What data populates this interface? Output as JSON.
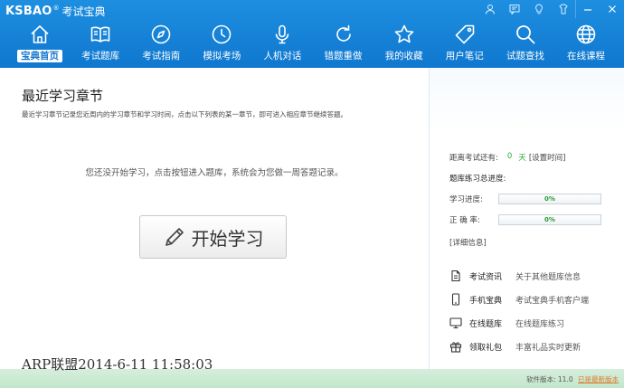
{
  "app": {
    "logo": "KSBAO",
    "registered": "®",
    "name": "考试宝典"
  },
  "nav": [
    {
      "label": "宝典首页",
      "icon": "home-icon",
      "active": true
    },
    {
      "label": "考试题库",
      "icon": "book-icon"
    },
    {
      "label": "考试指南",
      "icon": "compass-icon"
    },
    {
      "label": "模拟考场",
      "icon": "clock-icon"
    },
    {
      "label": "人机对话",
      "icon": "microphone-icon"
    },
    {
      "label": "错题重做",
      "icon": "redo-icon"
    },
    {
      "label": "我的收藏",
      "icon": "star-icon"
    },
    {
      "label": "用户笔记",
      "icon": "tag-icon"
    },
    {
      "label": "试题查找",
      "icon": "search-icon"
    },
    {
      "label": "在线课程",
      "icon": "globe-icon"
    }
  ],
  "main": {
    "title": "最近学习章节",
    "description": "最近学习章节记录您近周内的学习章节和学习时间，点击以下列表的某一章节，即可进入相应章节继续答题。",
    "empty_message": "您还没开始学习，点击按钮进入题库，系统会为您做一周答题记录。",
    "start_button": "开始学习"
  },
  "sidebar": {
    "countdown_label": "距离考试还有:",
    "countdown_value": "0",
    "countdown_unit": "天",
    "set_time_link": "[设置时间]",
    "total_progress_label": "题库练习总进度:",
    "study_progress_label": "学习进度:",
    "study_progress_value": "0%",
    "accuracy_label": "正 确 率:",
    "accuracy_value": "0%",
    "details_link": "[详细信息]",
    "tools": [
      {
        "name": "考试资讯",
        "desc": "关于其他题库信息",
        "icon": "document-icon"
      },
      {
        "name": "手机宝典",
        "desc": "考试宝典手机客户端",
        "icon": "phone-icon"
      },
      {
        "name": "在线题库",
        "desc": "在线题库练习",
        "icon": "monitor-icon"
      },
      {
        "name": "领取礼包",
        "desc": "丰富礼品实时更新",
        "icon": "gift-icon"
      }
    ]
  },
  "status": {
    "watermark": "ARP联盟2014-6-11 11:58:03",
    "version_label": "软件版本: 11.0",
    "latest_label": "已是最新版本"
  },
  "colors": {
    "header": "#1e8fe0",
    "accent_green": "#2aa830",
    "status_bar": "#c2e6c9"
  }
}
